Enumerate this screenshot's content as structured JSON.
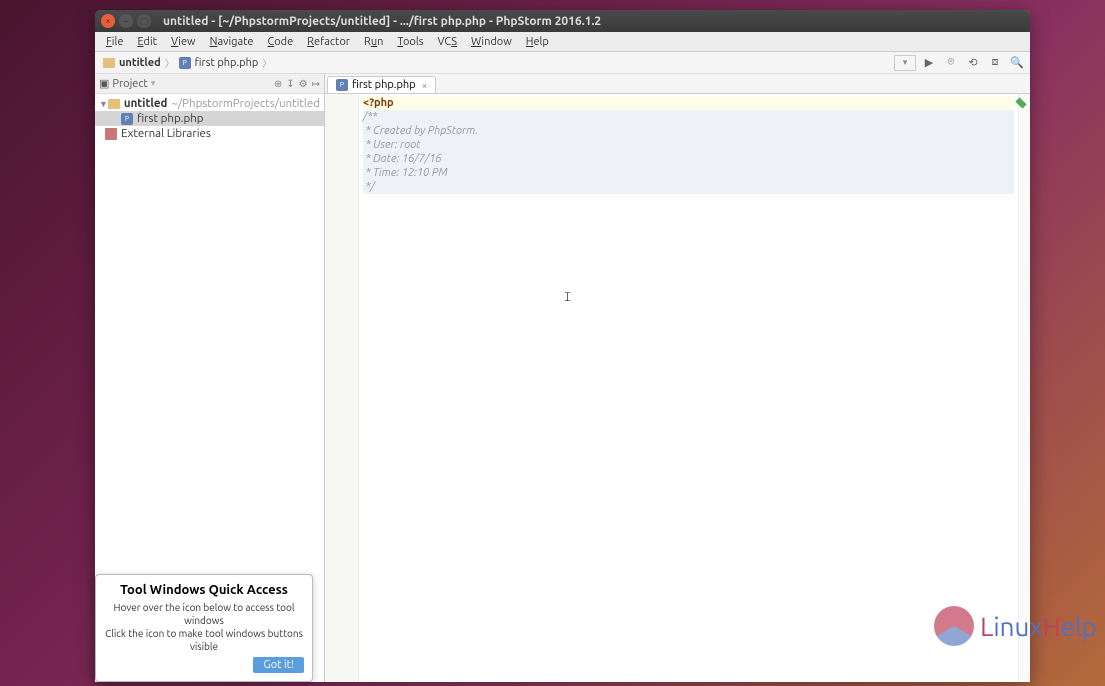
{
  "titlebar": {
    "title": "untitled - [~/PhpstormProjects/untitled] - .../first php.php - PhpStorm 2016.1.2"
  },
  "menubar": {
    "items": [
      {
        "label": "File",
        "u": 0
      },
      {
        "label": "Edit",
        "u": 0
      },
      {
        "label": "View",
        "u": 0
      },
      {
        "label": "Navigate",
        "u": 0
      },
      {
        "label": "Code",
        "u": 0
      },
      {
        "label": "Refactor",
        "u": 0
      },
      {
        "label": "Run",
        "u": 1
      },
      {
        "label": "Tools",
        "u": 0
      },
      {
        "label": "VCS",
        "u": 2
      },
      {
        "label": "Window",
        "u": 0
      },
      {
        "label": "Help",
        "u": 0
      }
    ]
  },
  "breadcrumb": {
    "root": "untitled",
    "file": "first php.php"
  },
  "project_pane": {
    "header": "Project",
    "root_name": "untitled",
    "root_path": "~/PhpstormProjects/untitled",
    "file": "first php.php",
    "external": "External Libraries"
  },
  "editor": {
    "tab_label": "first php.php",
    "code": {
      "line1": "<?php",
      "line2": "/**",
      "line3": " * Created by PhpStorm.",
      "line4": " * User: root",
      "line5": " * Date: 16/7/16",
      "line6": " * Time: 12:10 PM",
      "line7": " */"
    }
  },
  "tooltip": {
    "title": "Tool Windows Quick Access",
    "body1": "Hover over the icon below to access tool windows",
    "body2": "Click the icon to make tool windows buttons visible",
    "button": "Got it!"
  },
  "watermark": {
    "part1": "L",
    "part2": "inux",
    "part3": "H",
    "part4": "elp"
  }
}
